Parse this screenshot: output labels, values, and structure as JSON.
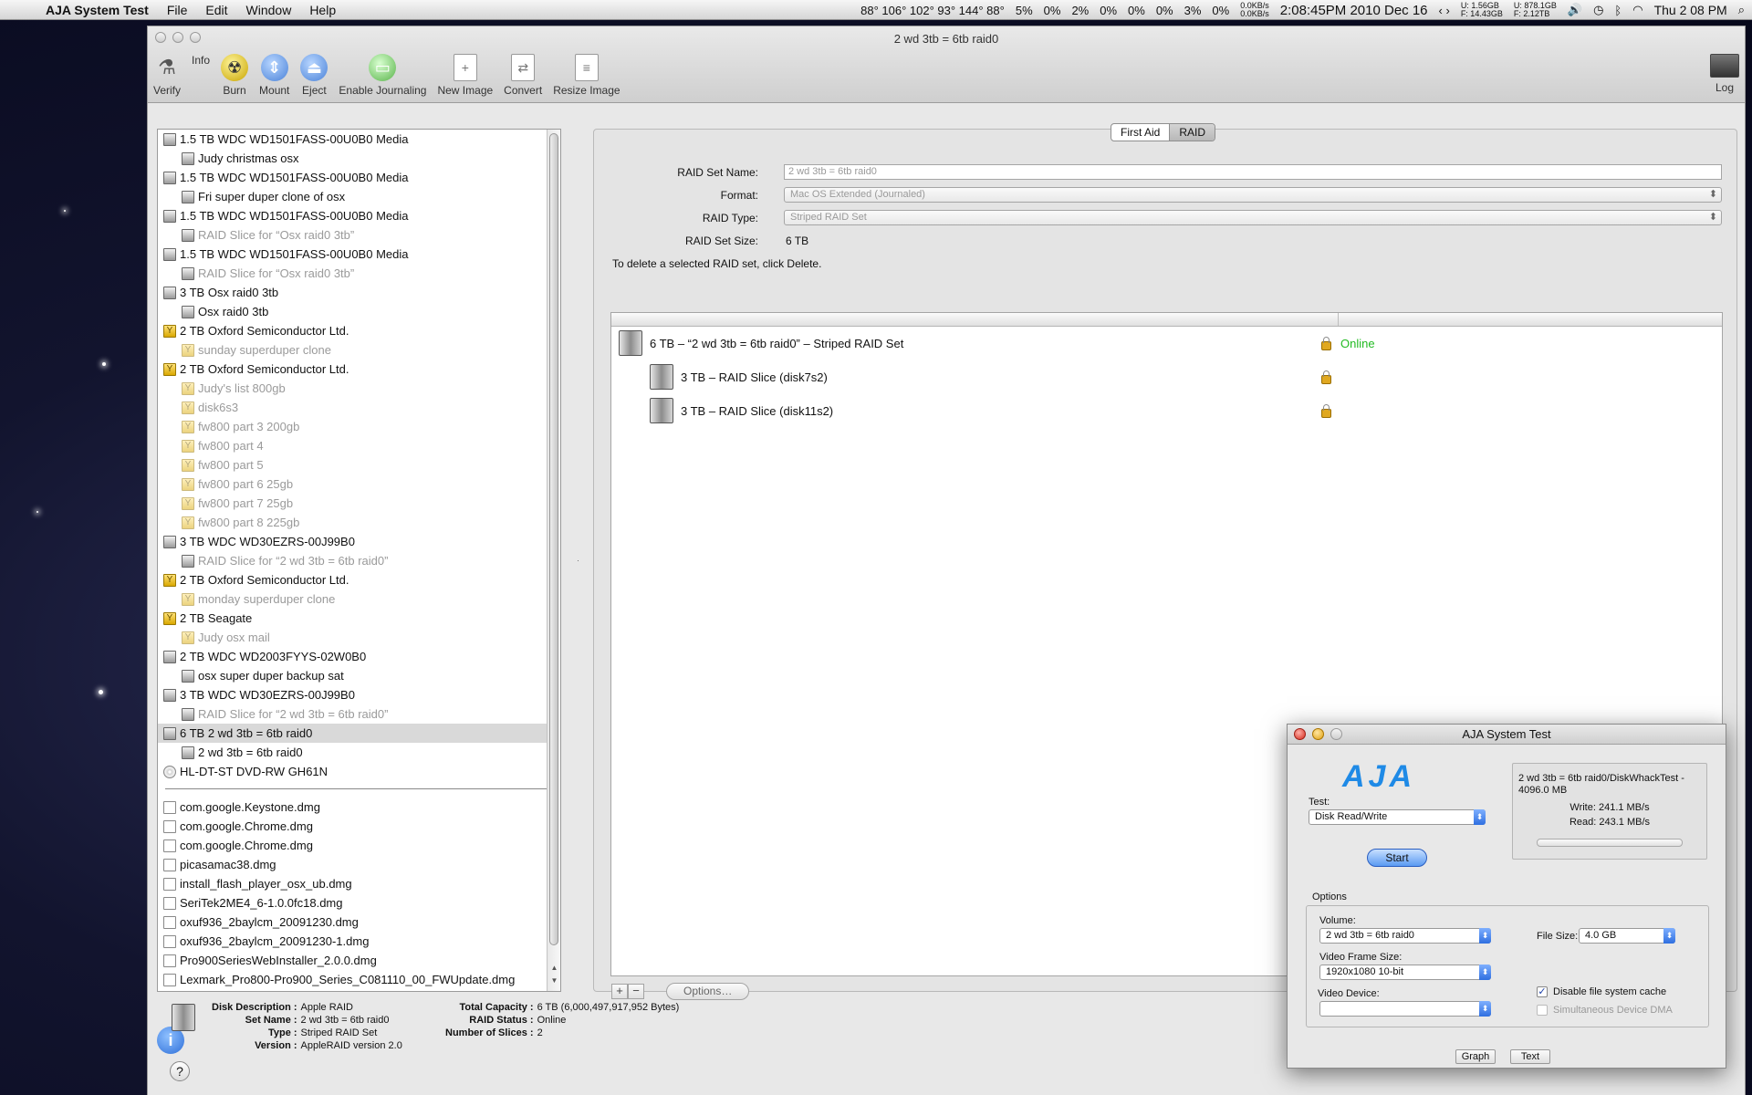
{
  "menubar": {
    "app": "AJA System Test",
    "items": [
      "File",
      "Edit",
      "Window",
      "Help"
    ],
    "temps": "88° 106° 102° 93° 144° 88°",
    "cpu": [
      "5%",
      "0%",
      "2%",
      "0%",
      "0%",
      "0%",
      "3%",
      "0%"
    ],
    "net_up": "0.0KB/s",
    "net_down": "0.0KB/s",
    "datetime": "2:08:45PM 2010 Dec 16",
    "mem_u": "U: 1.56GB",
    "mem_f": "F: 14.43GB",
    "disk_u": "U: 878.1GB",
    "disk_f": "F: 2.12TB",
    "clock": "Thu 2 08 PM"
  },
  "window": {
    "title": "2 wd 3tb = 6tb raid0",
    "toolbar": [
      "Verify",
      "Info",
      "Burn",
      "Mount",
      "Eject",
      "Enable Journaling",
      "New Image",
      "Convert",
      "Resize Image"
    ],
    "log": "Log"
  },
  "sidebar": {
    "disks": [
      {
        "label": "1.5 TB WDC WD1501FASS-00U0B0 Media",
        "icon": "hd",
        "child": false,
        "dim": false
      },
      {
        "label": "Judy christmas osx",
        "icon": "hd",
        "child": true,
        "dim": false
      },
      {
        "label": "1.5 TB WDC WD1501FASS-00U0B0 Media",
        "icon": "hd",
        "child": false,
        "dim": false
      },
      {
        "label": "Fri super duper clone of osx",
        "icon": "hd",
        "child": true,
        "dim": false
      },
      {
        "label": "1.5 TB WDC WD1501FASS-00U0B0 Media",
        "icon": "hd",
        "child": false,
        "dim": false
      },
      {
        "label": "RAID Slice for “Osx raid0 3tb”",
        "icon": "hd",
        "child": true,
        "dim": true
      },
      {
        "label": "1.5 TB WDC WD1501FASS-00U0B0 Media",
        "icon": "hd",
        "child": false,
        "dim": false
      },
      {
        "label": "RAID Slice for “Osx raid0 3tb”",
        "icon": "hd",
        "child": true,
        "dim": true
      },
      {
        "label": "3 TB Osx raid0 3tb",
        "icon": "hd",
        "child": false,
        "dim": false
      },
      {
        "label": "Osx raid0 3tb",
        "icon": "hd",
        "child": true,
        "dim": false
      },
      {
        "label": "2 TB Oxford Semiconductor Ltd.",
        "icon": "fw",
        "child": false,
        "dim": false
      },
      {
        "label": "sunday superduper clone",
        "icon": "fw",
        "child": true,
        "dim": true
      },
      {
        "label": "2 TB Oxford Semiconductor Ltd.",
        "icon": "fw",
        "child": false,
        "dim": false
      },
      {
        "label": "Judy's list 800gb",
        "icon": "fw",
        "child": true,
        "dim": true
      },
      {
        "label": "disk6s3",
        "icon": "fw",
        "child": true,
        "dim": true
      },
      {
        "label": "fw800 part 3 200gb",
        "icon": "fw",
        "child": true,
        "dim": true
      },
      {
        "label": "fw800 part 4",
        "icon": "fw",
        "child": true,
        "dim": true
      },
      {
        "label": "fw800 part 5",
        "icon": "fw",
        "child": true,
        "dim": true
      },
      {
        "label": "fw800 part 6 25gb",
        "icon": "fw",
        "child": true,
        "dim": true
      },
      {
        "label": "fw800 part 7 25gb",
        "icon": "fw",
        "child": true,
        "dim": true
      },
      {
        "label": "fw800  part 8 225gb",
        "icon": "fw",
        "child": true,
        "dim": true
      },
      {
        "label": "3 TB WDC WD30EZRS-00J99B0",
        "icon": "hd",
        "child": false,
        "dim": false
      },
      {
        "label": "RAID Slice for “2 wd 3tb = 6tb raid0”",
        "icon": "hd",
        "child": true,
        "dim": true
      },
      {
        "label": "2 TB Oxford Semiconductor Ltd.",
        "icon": "fw",
        "child": false,
        "dim": false
      },
      {
        "label": "monday superduper clone",
        "icon": "fw",
        "child": true,
        "dim": true
      },
      {
        "label": "2 TB Seagate",
        "icon": "fw",
        "child": false,
        "dim": false
      },
      {
        "label": "Judy osx mail",
        "icon": "fw",
        "child": true,
        "dim": true
      },
      {
        "label": "2 TB WDC WD2003FYYS-02W0B0",
        "icon": "hd",
        "child": false,
        "dim": false
      },
      {
        "label": "osx super duper backup sat",
        "icon": "hd",
        "child": true,
        "dim": false
      },
      {
        "label": "3 TB WDC WD30EZRS-00J99B0",
        "icon": "hd",
        "child": false,
        "dim": false
      },
      {
        "label": "RAID Slice for “2 wd 3tb = 6tb raid0”",
        "icon": "hd",
        "child": true,
        "dim": true
      },
      {
        "label": "6 TB 2 wd 3tb = 6tb raid0",
        "icon": "hd",
        "child": false,
        "dim": false,
        "selected": true
      },
      {
        "label": "2 wd 3tb = 6tb raid0",
        "icon": "hd",
        "child": true,
        "dim": false
      },
      {
        "label": "HL-DT-ST DVD-RW GH61N",
        "icon": "cd",
        "child": false,
        "dim": false
      }
    ],
    "images": [
      "com.google.Keystone.dmg",
      "com.google.Chrome.dmg",
      "com.google.Chrome.dmg",
      "picasamac38.dmg",
      "install_flash_player_osx_ub.dmg",
      "SeriTek2ME4_6-1.0.0fc18.dmg",
      "oxuf936_2baylcm_20091230.dmg",
      "oxuf936_2baylcm_20091230-1.dmg",
      "Pro900SeriesWebInstaller_2.0.0.dmg",
      "Lexmark_Pro800-Pro900_Series_C081110_00_FWUpdate.dmg"
    ]
  },
  "tabs": {
    "first_aid": "First Aid",
    "raid": "RAID"
  },
  "raid": {
    "name_label": "RAID Set Name:",
    "name_value": "2 wd 3tb = 6tb raid0",
    "format_label": "Format:",
    "format_value": "Mac OS Extended (Journaled)",
    "type_label": "RAID Type:",
    "type_value": "Striped RAID Set",
    "size_label": "RAID Set Size:",
    "size_value": "6 TB",
    "hint": "To delete a selected RAID set, click Delete.",
    "set_row": "6 TB – “2 wd 3tb = 6tb raid0” – Striped RAID Set",
    "set_status": "Online",
    "slices": [
      "3 TB – RAID Slice (disk7s2)",
      "3 TB – RAID Slice (disk11s2)"
    ],
    "add": "+",
    "remove": "−",
    "options": "Options…"
  },
  "info": {
    "left": [
      {
        "k": "Disk Description :",
        "v": "Apple RAID"
      },
      {
        "k": "Set Name :",
        "v": "2 wd 3tb = 6tb raid0"
      },
      {
        "k": "Type :",
        "v": "Striped RAID Set"
      },
      {
        "k": "Version :",
        "v": "AppleRAID version 2.0"
      }
    ],
    "right": [
      {
        "k": "Total Capacity :",
        "v": "6 TB (6,000,497,917,952 Bytes)"
      },
      {
        "k": "RAID Status :",
        "v": "Online"
      },
      {
        "k": "Number of Slices :",
        "v": "2"
      }
    ],
    "help": "?"
  },
  "aja": {
    "title": "AJA System Test",
    "logo": "AJA",
    "test_label": "Test:",
    "test_value": "Disk Read/Write",
    "start": "Start",
    "result_path": "2 wd 3tb = 6tb raid0/DiskWhackTest - 4096.0 MB",
    "write": "Write: 241.1 MB/s",
    "read": "Read: 243.1 MB/s",
    "options_label": "Options",
    "volume_label": "Volume:",
    "volume_value": "2 wd 3tb = 6tb raid0",
    "file_size_label": "File Size:",
    "file_size_value": "4.0 GB",
    "frame_label": "Video Frame Size:",
    "frame_value": "1920x1080 10-bit",
    "device_label": "Video Device:",
    "device_value": "",
    "disable_cache": "Disable file system cache",
    "sim_dma": "Simultaneous Device DMA",
    "graph": "Graph",
    "text": "Text"
  }
}
